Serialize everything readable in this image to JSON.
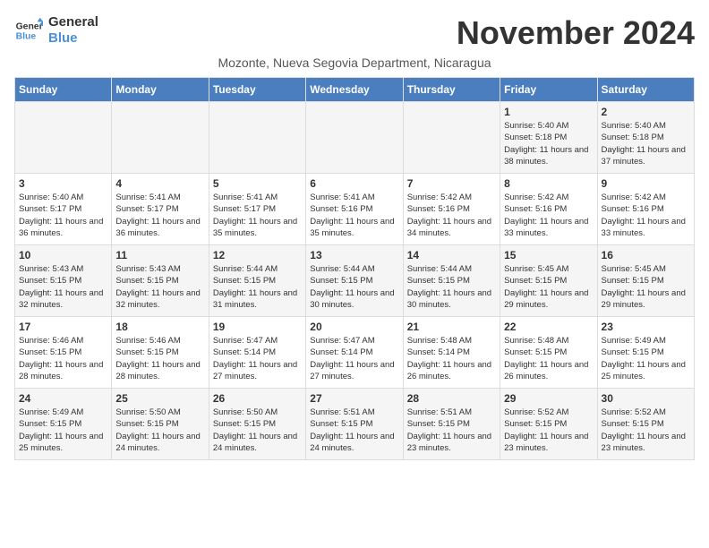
{
  "header": {
    "logo_line1": "General",
    "logo_line2": "Blue",
    "month_title": "November 2024",
    "subtitle": "Mozonte, Nueva Segovia Department, Nicaragua"
  },
  "days_of_week": [
    "Sunday",
    "Monday",
    "Tuesday",
    "Wednesday",
    "Thursday",
    "Friday",
    "Saturday"
  ],
  "weeks": [
    [
      {
        "day": "",
        "info": ""
      },
      {
        "day": "",
        "info": ""
      },
      {
        "day": "",
        "info": ""
      },
      {
        "day": "",
        "info": ""
      },
      {
        "day": "",
        "info": ""
      },
      {
        "day": "1",
        "info": "Sunrise: 5:40 AM\nSunset: 5:18 PM\nDaylight: 11 hours and 38 minutes."
      },
      {
        "day": "2",
        "info": "Sunrise: 5:40 AM\nSunset: 5:18 PM\nDaylight: 11 hours and 37 minutes."
      }
    ],
    [
      {
        "day": "3",
        "info": "Sunrise: 5:40 AM\nSunset: 5:17 PM\nDaylight: 11 hours and 36 minutes."
      },
      {
        "day": "4",
        "info": "Sunrise: 5:41 AM\nSunset: 5:17 PM\nDaylight: 11 hours and 36 minutes."
      },
      {
        "day": "5",
        "info": "Sunrise: 5:41 AM\nSunset: 5:17 PM\nDaylight: 11 hours and 35 minutes."
      },
      {
        "day": "6",
        "info": "Sunrise: 5:41 AM\nSunset: 5:16 PM\nDaylight: 11 hours and 35 minutes."
      },
      {
        "day": "7",
        "info": "Sunrise: 5:42 AM\nSunset: 5:16 PM\nDaylight: 11 hours and 34 minutes."
      },
      {
        "day": "8",
        "info": "Sunrise: 5:42 AM\nSunset: 5:16 PM\nDaylight: 11 hours and 33 minutes."
      },
      {
        "day": "9",
        "info": "Sunrise: 5:42 AM\nSunset: 5:16 PM\nDaylight: 11 hours and 33 minutes."
      }
    ],
    [
      {
        "day": "10",
        "info": "Sunrise: 5:43 AM\nSunset: 5:15 PM\nDaylight: 11 hours and 32 minutes."
      },
      {
        "day": "11",
        "info": "Sunrise: 5:43 AM\nSunset: 5:15 PM\nDaylight: 11 hours and 32 minutes."
      },
      {
        "day": "12",
        "info": "Sunrise: 5:44 AM\nSunset: 5:15 PM\nDaylight: 11 hours and 31 minutes."
      },
      {
        "day": "13",
        "info": "Sunrise: 5:44 AM\nSunset: 5:15 PM\nDaylight: 11 hours and 30 minutes."
      },
      {
        "day": "14",
        "info": "Sunrise: 5:44 AM\nSunset: 5:15 PM\nDaylight: 11 hours and 30 minutes."
      },
      {
        "day": "15",
        "info": "Sunrise: 5:45 AM\nSunset: 5:15 PM\nDaylight: 11 hours and 29 minutes."
      },
      {
        "day": "16",
        "info": "Sunrise: 5:45 AM\nSunset: 5:15 PM\nDaylight: 11 hours and 29 minutes."
      }
    ],
    [
      {
        "day": "17",
        "info": "Sunrise: 5:46 AM\nSunset: 5:15 PM\nDaylight: 11 hours and 28 minutes."
      },
      {
        "day": "18",
        "info": "Sunrise: 5:46 AM\nSunset: 5:15 PM\nDaylight: 11 hours and 28 minutes."
      },
      {
        "day": "19",
        "info": "Sunrise: 5:47 AM\nSunset: 5:14 PM\nDaylight: 11 hours and 27 minutes."
      },
      {
        "day": "20",
        "info": "Sunrise: 5:47 AM\nSunset: 5:14 PM\nDaylight: 11 hours and 27 minutes."
      },
      {
        "day": "21",
        "info": "Sunrise: 5:48 AM\nSunset: 5:14 PM\nDaylight: 11 hours and 26 minutes."
      },
      {
        "day": "22",
        "info": "Sunrise: 5:48 AM\nSunset: 5:15 PM\nDaylight: 11 hours and 26 minutes."
      },
      {
        "day": "23",
        "info": "Sunrise: 5:49 AM\nSunset: 5:15 PM\nDaylight: 11 hours and 25 minutes."
      }
    ],
    [
      {
        "day": "24",
        "info": "Sunrise: 5:49 AM\nSunset: 5:15 PM\nDaylight: 11 hours and 25 minutes."
      },
      {
        "day": "25",
        "info": "Sunrise: 5:50 AM\nSunset: 5:15 PM\nDaylight: 11 hours and 24 minutes."
      },
      {
        "day": "26",
        "info": "Sunrise: 5:50 AM\nSunset: 5:15 PM\nDaylight: 11 hours and 24 minutes."
      },
      {
        "day": "27",
        "info": "Sunrise: 5:51 AM\nSunset: 5:15 PM\nDaylight: 11 hours and 24 minutes."
      },
      {
        "day": "28",
        "info": "Sunrise: 5:51 AM\nSunset: 5:15 PM\nDaylight: 11 hours and 23 minutes."
      },
      {
        "day": "29",
        "info": "Sunrise: 5:52 AM\nSunset: 5:15 PM\nDaylight: 11 hours and 23 minutes."
      },
      {
        "day": "30",
        "info": "Sunrise: 5:52 AM\nSunset: 5:15 PM\nDaylight: 11 hours and 23 minutes."
      }
    ]
  ]
}
